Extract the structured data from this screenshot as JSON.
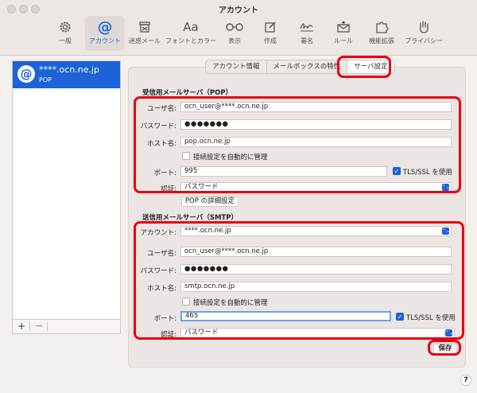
{
  "window": {
    "title": "アカウント"
  },
  "toolbar": {
    "items": [
      {
        "label": "一般",
        "icon": "gear-icon"
      },
      {
        "label": "アカウント",
        "icon": "at-icon"
      },
      {
        "label": "迷惑メール",
        "icon": "junk-icon"
      },
      {
        "label": "フォントとカラー",
        "icon": "fonts-icon",
        "glyph": "Aa"
      },
      {
        "label": "表示",
        "icon": "glasses-icon"
      },
      {
        "label": "作成",
        "icon": "compose-icon"
      },
      {
        "label": "署名",
        "icon": "signature-icon"
      },
      {
        "label": "ルール",
        "icon": "rules-icon"
      },
      {
        "label": "機能拡張",
        "icon": "extensions-icon"
      },
      {
        "label": "プライバシー",
        "icon": "hand-icon"
      }
    ]
  },
  "accounts": {
    "items": [
      {
        "icon_glyph": "@",
        "name": "****.ocn.ne.jp",
        "type": "POP"
      }
    ],
    "add_label": "+",
    "remove_label": "—"
  },
  "tabs": [
    {
      "label": "アカウント情報"
    },
    {
      "label": "メールボックスの特性"
    },
    {
      "label": "サーバ設定"
    }
  ],
  "incoming": {
    "title": "受信用メールサーバ（POP）",
    "username_label": "ユーザ名:",
    "username": "ocn_user@****.ocn.ne.jp",
    "password_label": "パスワード:",
    "password": "●●●●●●●",
    "host_label": "ホスト名:",
    "host": "pop.ocn.ne.jp",
    "auto_manage_label": "接続設定を自動的に管理",
    "port_label": "ポート:",
    "port": "995",
    "tls_label": "TLS/SSL を使用",
    "tls_check": "✓",
    "auth_label": "認証:",
    "auth": "パスワード",
    "advanced_button": "POP の詳細設定"
  },
  "outgoing": {
    "title": "送信用メールサーバ（SMTP）",
    "account_label": "アカウント:",
    "account": "****.ocn.ne.jp",
    "username_label": "ユーザ名:",
    "username": "ocn_user@****.ocn.ne.jp",
    "password_label": "パスワード:",
    "password": "●●●●●●●",
    "host_label": "ホスト名:",
    "host": "smtp.ocn.ne.jp",
    "auto_manage_label": "接続設定を自動的に管理",
    "port_label": "ポート:",
    "port": "465",
    "tls_label": "TLS/SSL を使用",
    "tls_check": "✓",
    "auth_label": "認証:",
    "auth": "パスワード"
  },
  "save_button": "保存",
  "help_label": "?",
  "select_arrow": "⌃⌄",
  "colors": {
    "accent": "#1b63d6",
    "highlight": "#e8000f"
  }
}
